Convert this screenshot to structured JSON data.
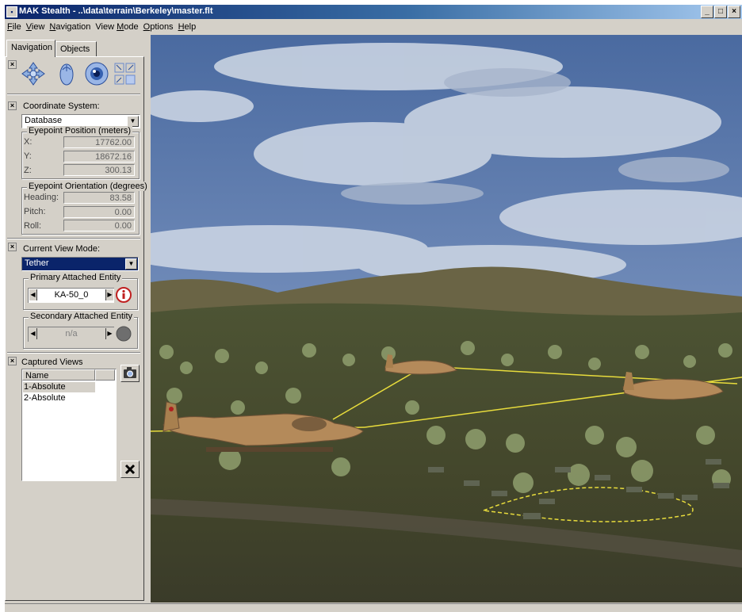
{
  "window": {
    "title": "MAK Stealth - ..\\data\\terrain\\Berkeley\\master.flt",
    "buttons": {
      "minimize": "_",
      "maximize": "□",
      "close": "×"
    }
  },
  "menu": {
    "items": [
      {
        "accel": "F",
        "rest": "ile"
      },
      {
        "accel": "V",
        "rest": "iew"
      },
      {
        "accel": "N",
        "rest": "avigation"
      },
      {
        "pre": "View ",
        "accel": "M",
        "rest": "ode"
      },
      {
        "accel": "O",
        "rest": "ptions"
      },
      {
        "accel": "H",
        "rest": "elp"
      }
    ]
  },
  "tabs": {
    "navigation": "Navigation",
    "objects": "Objects"
  },
  "nav_icons": [
    "move-cross-icon",
    "mouse-icon",
    "eye-icon",
    "fullscreen-icon"
  ],
  "coordinate": {
    "label": "Coordinate System:",
    "value": "Database"
  },
  "eyepoint_position": {
    "title": "Eyepoint Position (meters)",
    "x_label": "X:",
    "x": "17762.00",
    "y_label": "Y:",
    "y": "18672.16",
    "z_label": "Z:",
    "z": "300.13"
  },
  "eyepoint_orientation": {
    "title": "Eyepoint Orientation (degrees)",
    "heading_label": "Heading:",
    "heading": "83.58",
    "pitch_label": "Pitch:",
    "pitch": "0.00",
    "roll_label": "Roll:",
    "roll": "0.00"
  },
  "view_mode": {
    "label": "Current View Mode:",
    "value": "Tether"
  },
  "primary_entity": {
    "title": "Primary Attached Entity",
    "value": "KA-50_0"
  },
  "secondary_entity": {
    "title": "Secondary Attached Entity",
    "value": "n/a"
  },
  "captured_views": {
    "label": "Captured Views",
    "column": "Name",
    "rows": [
      "1-Absolute",
      "2-Absolute"
    ]
  },
  "colors": {
    "title_active": "#0a246a",
    "face": "#d4d0c8",
    "selection": "#0a246a",
    "sky": "#3d5e93",
    "terrain": "#4f5233",
    "helicopter": "#b48a5a",
    "waypoint_line": "#e8dc3c"
  }
}
